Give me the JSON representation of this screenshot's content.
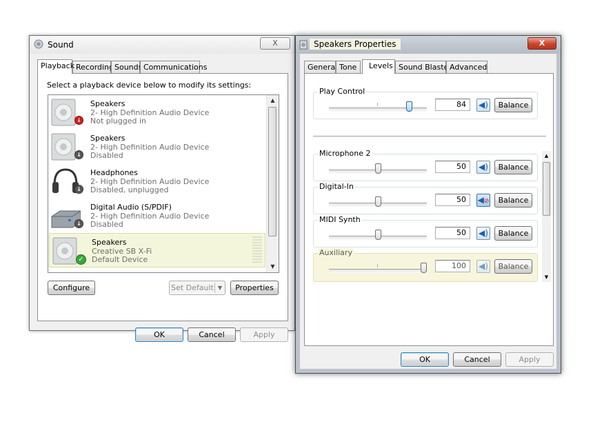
{
  "sound_window": {
    "title": "Sound",
    "close_label": "X",
    "tabs": [
      "Playback",
      "Recording",
      "Sounds",
      "Communications"
    ],
    "active_tab": 0,
    "instruction": "Select a playback device below to modify its settings:",
    "devices": [
      {
        "name": "Speakers",
        "desc": "2- High Definition Audio Device",
        "status": "Not plugged in",
        "badge": "red",
        "icon": "speaker-icon"
      },
      {
        "name": "Speakers",
        "desc": "2- High Definition Audio Device",
        "status": "Disabled",
        "badge": "disabled",
        "icon": "speaker-icon"
      },
      {
        "name": "Headphones",
        "desc": "2- High Definition Audio Device",
        "status": "Disabled, unplugged",
        "badge": "disabled",
        "icon": "headphones-icon"
      },
      {
        "name": "Digital Audio (S/PDIF)",
        "desc": "2- High Definition Audio Device",
        "status": "Disabled",
        "badge": "disabled",
        "icon": "digital-audio-icon"
      },
      {
        "name": "Speakers",
        "desc": "Creative SB X-Fi",
        "status": "Default Device",
        "badge": "green",
        "icon": "speaker-icon"
      }
    ],
    "buttons": {
      "configure": "Configure",
      "set_default": "Set Default",
      "properties": "Properties",
      "ok": "OK",
      "cancel": "Cancel",
      "apply": "Apply"
    }
  },
  "speakers_window": {
    "title": "Speakers Properties",
    "close_label": "X",
    "tabs": [
      "General",
      "Tone",
      "Levels",
      "Sound Blaster",
      "Advanced"
    ],
    "active_tab": 2,
    "levels": [
      {
        "label": "Play Control",
        "value": "84",
        "level": 0.84,
        "muted": false
      },
      {
        "label": "Microphone 2",
        "value": "50",
        "level": 0.5,
        "muted": false
      },
      {
        "label": "Digital-In",
        "value": "50",
        "level": 0.5,
        "muted": true
      },
      {
        "label": "MIDI Synth",
        "value": "50",
        "level": 0.5,
        "muted": false
      },
      {
        "label": "Auxiliary",
        "value": "100",
        "level": 1.0,
        "muted": false
      }
    ],
    "balance_label": "Balance",
    "buttons": {
      "ok": "OK",
      "cancel": "Cancel",
      "apply": "Apply"
    }
  },
  "colors": {
    "selection": "#f4f6dc",
    "mute_blue": "#1a5fb4",
    "not_plugged_red": "#cc2222",
    "default_green": "#3aa53a"
  }
}
